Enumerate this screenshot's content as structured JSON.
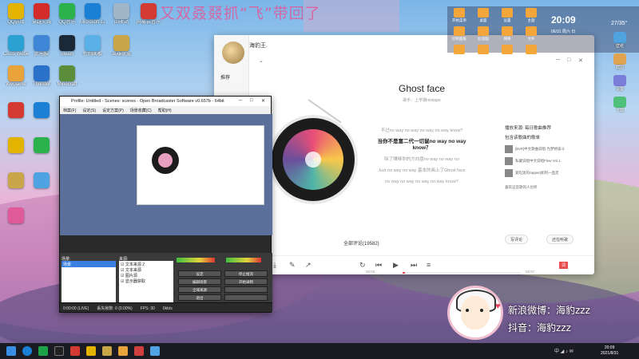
{
  "banner_text": "又双叒叕抓“飞”带回了",
  "desktop_icons": [
    {
      "label": "QQ游戏",
      "color": "#e2b300"
    },
    {
      "label": "穿越火线",
      "color": "#d42b2b"
    },
    {
      "label": "QQ音乐",
      "color": "#2bb24c"
    },
    {
      "label": "Microsoft Edge",
      "color": "#1b7fd6"
    },
    {
      "label": "回收站",
      "color": "#9fb6c8"
    },
    {
      "label": "网易云音乐",
      "color": "#d33a31"
    },
    {
      "label": "Cisco Webex",
      "color": "#2aa1d0"
    },
    {
      "label": "此电脑",
      "color": "#3f87d6"
    },
    {
      "label": "Steam",
      "color": "#1b2838"
    },
    {
      "label": "控制面板",
      "color": "#5bb0e8"
    },
    {
      "label": "英雄联盟",
      "color": "#c9a648"
    },
    {
      "label": "WeGame",
      "color": "#e8a33a"
    },
    {
      "label": "Thunder",
      "color": "#2a72c9"
    },
    {
      "label": "Minecraft",
      "color": "#5c8d3a"
    }
  ],
  "music": {
    "user": "海豹王.",
    "nav_recommend": "推荐",
    "song_title": "Ghost face",
    "song_artist": "歌手：上学期mixtape",
    "lyrics": [
      {
        "text": "不过no way no way no way no way know?",
        "current": false
      },
      {
        "text": "当你不是富二代一切鼠no way no way know？",
        "current": true
      },
      {
        "text": "除了赚够你的方向盘no way no way no",
        "current": false
      },
      {
        "text": "Just no way no way 基本的画上了Ghost face",
        "current": false
      },
      {
        "text": "no way no way no way no way know?",
        "current": false
      }
    ],
    "rec_header": "播放来源: 每日歌曲推荐",
    "rec_sub": "包含该歌曲的歌单",
    "playlists": [
      "[BvR]中文歌曲说唱-为梦想奋斗",
      "私藏说唱中文说唱Flow Vol.1",
      "爱吃饭的rapper|如何一直走"
    ],
    "rec_more": "喜欢这首歌的人也听",
    "comments_label": "全部评论(19582)",
    "pill_write": "写评论",
    "pill_listening": "还在听歌",
    "time_current": "00:00",
    "time_total": "02:57",
    "progress": 0.02,
    "lyric_btn": "词",
    "accent": "#e94e4e"
  },
  "obs": {
    "title": "Profile: Untitled - Scenes: scenes - Open Broadcaster Software v0.657b - 64bit",
    "menu": [
      "档案(F)",
      "设定(S)",
      "设定方案(P)",
      "场景收藏(C)",
      "帮助(H)"
    ],
    "scenes_label": "场景:",
    "sources_label": "来源:",
    "selected_scene": "场景",
    "sources": [
      "文本来源 2",
      "文本来源",
      "图片源",
      "显示器获取"
    ],
    "buttons": [
      "设定",
      "停止推流",
      "编辑场景",
      "开始录制",
      "全域来源",
      "",
      "退出",
      ""
    ],
    "status": [
      "0:00:00 (LIVE)",
      "丢失帧数: 0 (0.00%)",
      "FPS: 30",
      "0kb/s"
    ]
  },
  "widget": {
    "clock": "20:09",
    "date": "06/31 周六 日",
    "temp": "27/35°",
    "grid": [
      "开始菜单",
      "桌面",
      "设置",
      "主题",
      "控制面板",
      "此电脑",
      "网络",
      "文件",
      "浏览器",
      "音乐",
      "相册",
      "回收站"
    ]
  },
  "right_icons": [
    {
      "label": "壁纸",
      "color": "#4fa3e0"
    },
    {
      "label": "截图",
      "color": "#e0a34f"
    },
    {
      "label": "设置",
      "color": "#7c7cd9"
    },
    {
      "label": "下载",
      "color": "#4fc07a"
    }
  ],
  "overlay": {
    "weibo": "新浪微博：海豹zzz",
    "douyin": "抖音：海豹zzz"
  },
  "taskbar": {
    "time": "20:09",
    "date": "2021/8/31",
    "tray": "中 ◢ ♪ ✉"
  }
}
